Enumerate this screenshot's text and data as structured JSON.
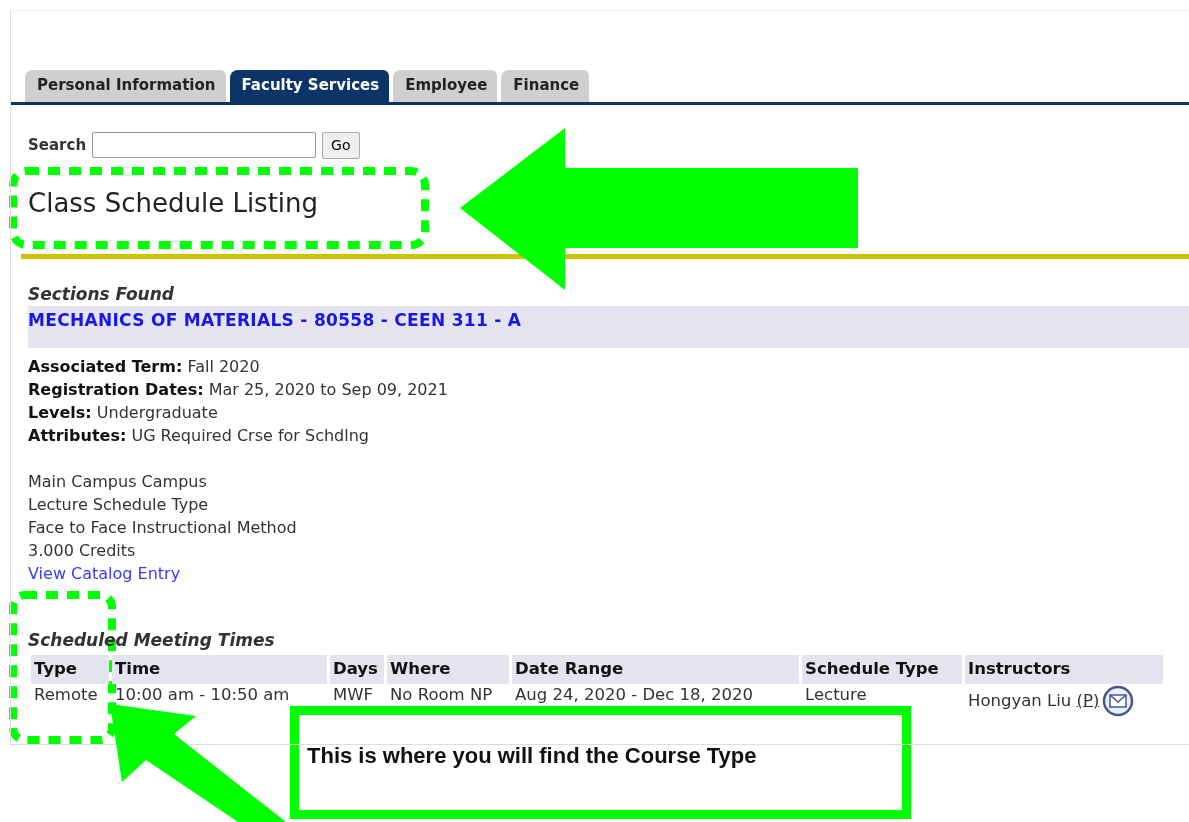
{
  "tabs": [
    {
      "label": "Personal Information",
      "selected": false
    },
    {
      "label": "Faculty Services",
      "selected": true
    },
    {
      "label": "Employee",
      "selected": false
    },
    {
      "label": "Finance",
      "selected": false
    }
  ],
  "search": {
    "label": "Search",
    "button": "Go"
  },
  "title": "Class Schedule Listing",
  "section_heading": "Sections Found",
  "section": {
    "title": "MECHANICS OF MATERIALS - 80558 - CEEN 311 - A",
    "fields": [
      {
        "label": "Associated Term:",
        "value": "Fall 2020"
      },
      {
        "label": "Registration Dates:",
        "value": "Mar 25, 2020 to Sep 09, 2021"
      },
      {
        "label": "Levels:",
        "value": "Undergraduate"
      },
      {
        "label": "Attributes:",
        "value": "UG Required Crse for Schdlng"
      }
    ],
    "lines": [
      "Main Campus Campus",
      "Lecture Schedule Type",
      "Face to Face Instructional Method",
      "3.000 Credits"
    ],
    "link": "View Catalog Entry"
  },
  "meetings": {
    "heading": "Scheduled Meeting Times",
    "columns": [
      "Type",
      "Time",
      "Days",
      "Where",
      "Date Range",
      "Schedule Type",
      "Instructors"
    ],
    "rows": [
      {
        "cells": [
          "Remote",
          "10:00 am - 10:50 am",
          "MWF",
          "No Room NP",
          "Aug 24, 2020 - Dec 18, 2020",
          "Lecture"
        ],
        "instructor": "Hongyan Liu",
        "instructor_tag": "(P)"
      }
    ]
  },
  "callout": {
    "text": "This is where you will find the Course Type"
  }
}
